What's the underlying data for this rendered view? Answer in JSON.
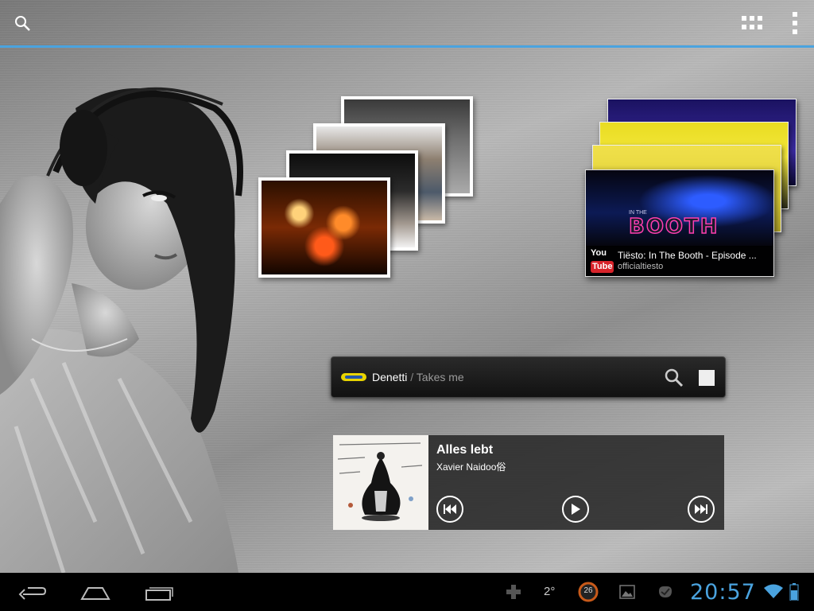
{
  "top_bar": {
    "search_icon": "search-icon",
    "apps_icon": "apps-grid-icon",
    "menu_icon": "overflow-menu-icon",
    "accent_color": "#4aa3df"
  },
  "youtube_widget": {
    "title": "Tiësto: In The Booth - Episode ...",
    "channel": "officialtiesto",
    "logo_you": "You",
    "logo_tube": "Tube",
    "banner_text": "BOOTH",
    "banner_prefix": "IN THE"
  },
  "music_bar": {
    "artist": "Denetti",
    "separator": " / ",
    "song": "Takes me"
  },
  "player": {
    "title": "Alles lebt",
    "artist": "Xavier Naidoo俗"
  },
  "system_bar": {
    "temperature": "2°",
    "notification_count": "26",
    "clock": "20:57",
    "clock_color": "#4aa3df"
  }
}
